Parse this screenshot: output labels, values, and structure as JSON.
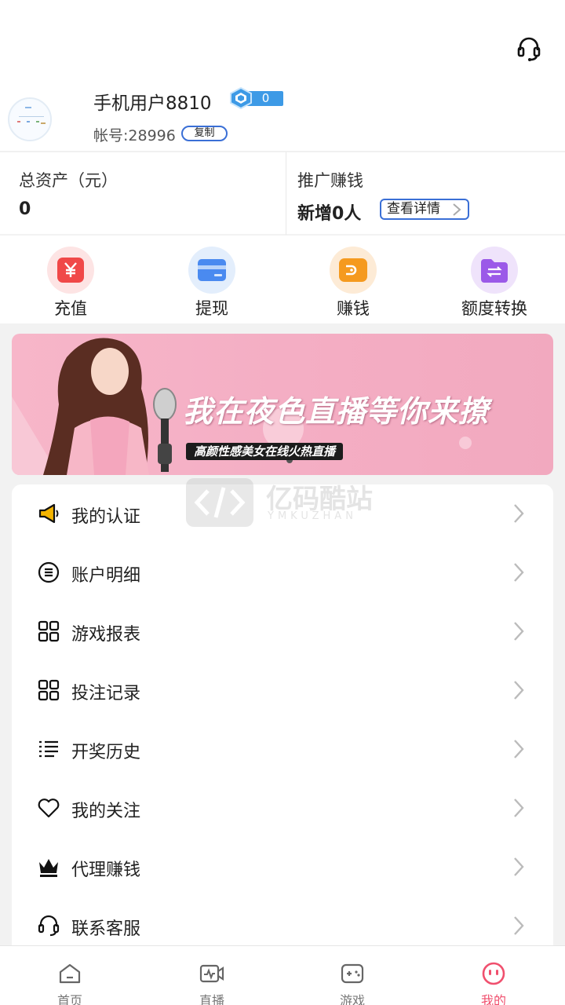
{
  "header": {
    "username": "手机用户8810",
    "level_value": "0",
    "account_label": "帐号:28996",
    "copy_label": "复制"
  },
  "stats": {
    "assets_label": "总资产（元）",
    "assets_value": "0",
    "promo_label": "推广赚钱",
    "promo_value": "新增0人",
    "detail_label": "查看详情"
  },
  "actions": [
    {
      "label": "充值",
      "icon": "yuan-icon",
      "color": "#f04848"
    },
    {
      "label": "提现",
      "icon": "card-icon",
      "color": "#4a8af0"
    },
    {
      "label": "赚钱",
      "icon": "wallet-icon",
      "color": "#f59a1f"
    },
    {
      "label": "额度转换",
      "icon": "transfer-icon",
      "color": "#9b59e8"
    }
  ],
  "banner": {
    "title": "我在夜色直播等你来撩",
    "subtitle": "高颜性感美女在线火热直播"
  },
  "watermark": {
    "text": "亿码酷站",
    "sub": "YMKUZHAN"
  },
  "menu": [
    {
      "label": "我的认证",
      "icon": "megaphone-icon"
    },
    {
      "label": "账户明细",
      "icon": "list-circle-icon"
    },
    {
      "label": "游戏报表",
      "icon": "grid-icon"
    },
    {
      "label": "投注记录",
      "icon": "grid-icon"
    },
    {
      "label": "开奖历史",
      "icon": "list-icon"
    },
    {
      "label": "我的关注",
      "icon": "heart-icon"
    },
    {
      "label": "代理赚钱",
      "icon": "crown-icon"
    },
    {
      "label": "联系客服",
      "icon": "headset-icon"
    }
  ],
  "tabs": [
    {
      "label": "首页",
      "icon": "home-icon"
    },
    {
      "label": "直播",
      "icon": "video-icon"
    },
    {
      "label": "游戏",
      "icon": "gamepad-icon"
    },
    {
      "label": "我的",
      "icon": "profile-icon",
      "active": true
    }
  ],
  "colors": {
    "accent": "#f0506e",
    "link_border": "#3a6fd6",
    "level": "#3d9ae6"
  }
}
